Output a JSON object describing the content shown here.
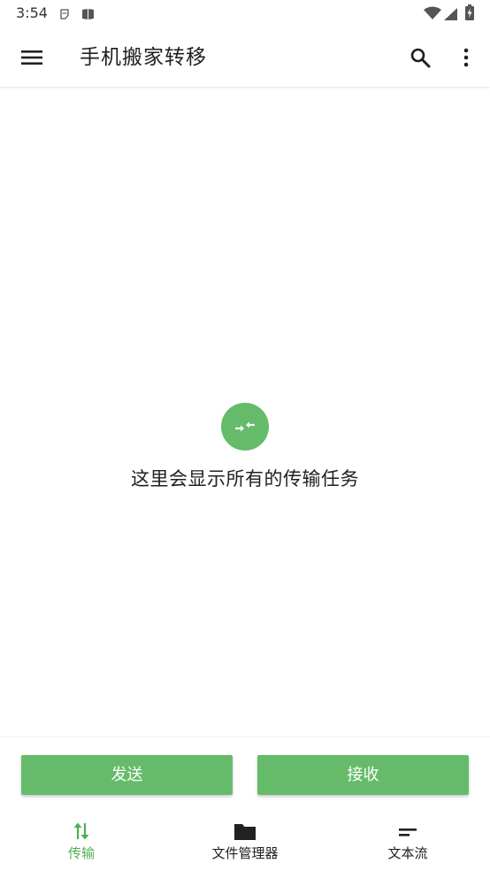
{
  "status_bar": {
    "time": "3:54"
  },
  "app_bar": {
    "title": "手机搬家转移",
    "menu_icon": "hamburger-menu-icon",
    "search_icon": "search-icon",
    "more_icon": "more-vert-icon"
  },
  "empty_state": {
    "icon": "transfer-arrows-icon",
    "message": "这里会显示所有的传输任务"
  },
  "actions": {
    "send_label": "发送",
    "receive_label": "接收"
  },
  "bottom_nav": {
    "items": [
      {
        "label": "传输",
        "icon": "swap-vertical-icon",
        "active": true
      },
      {
        "label": "文件管理器",
        "icon": "folder-icon",
        "active": false
      },
      {
        "label": "文本流",
        "icon": "short-text-icon",
        "active": false
      }
    ]
  },
  "colors": {
    "accent": "#66bb6a",
    "active_nav": "#4caf50",
    "text": "#212121",
    "background": "#ffffff"
  }
}
